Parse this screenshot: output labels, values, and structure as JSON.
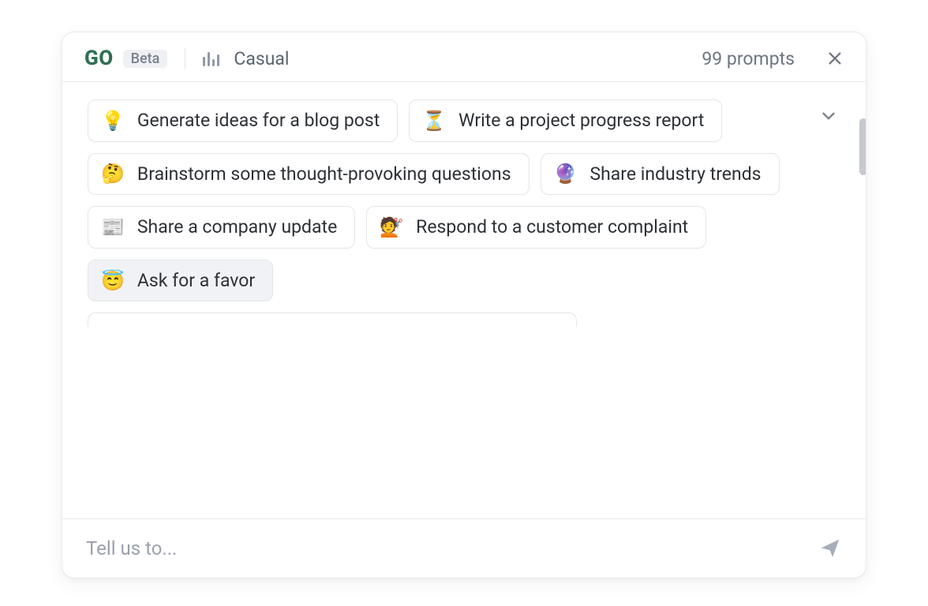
{
  "header": {
    "logo": "GO",
    "beta_badge": "Beta",
    "tone_label": "Casual",
    "prompts_remaining": "99 prompts"
  },
  "suggestions": [
    {
      "icon": "💡",
      "label": "Generate ideas for a blog post",
      "highlight": false
    },
    {
      "icon": "⏳",
      "label": "Write a project progress report",
      "highlight": false
    },
    {
      "icon": "🤔",
      "label": "Brainstorm some thought-provoking questions",
      "highlight": false
    },
    {
      "icon": "🔮",
      "label": "Share industry trends",
      "highlight": false
    },
    {
      "icon": "📰",
      "label": "Share a company update",
      "highlight": false
    },
    {
      "icon": "💇",
      "label": "Respond to a customer complaint",
      "highlight": false
    },
    {
      "icon": "😇",
      "label": "Ask for a favor",
      "highlight": true
    }
  ],
  "input": {
    "placeholder": "Tell us to..."
  }
}
